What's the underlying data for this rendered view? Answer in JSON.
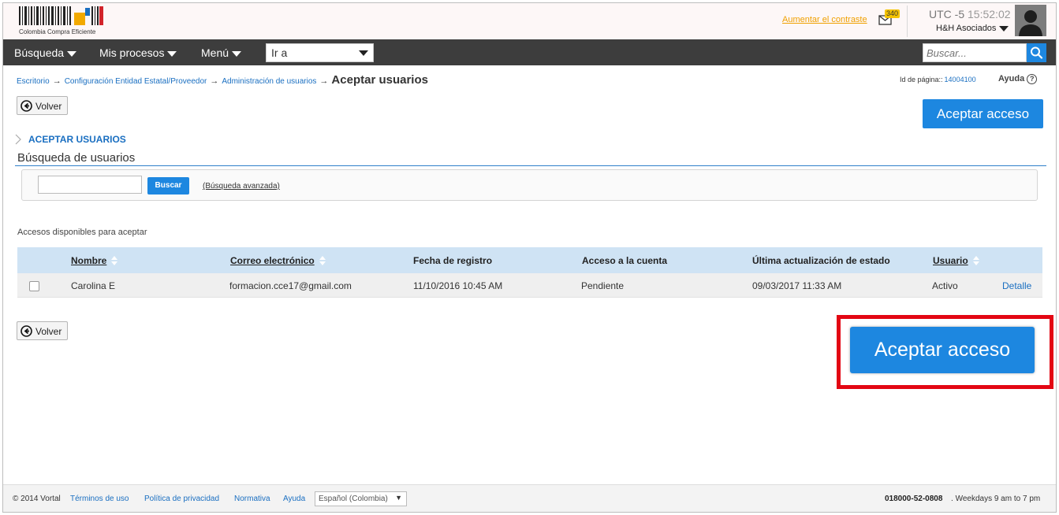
{
  "header": {
    "logo_caption": "Colombia Compra Eficiente",
    "contrast_link": "Aumentar el contraste",
    "mail_count": "340",
    "timezone": "UTC -5",
    "time": "15:52:02",
    "company": "H&H Asociados"
  },
  "nav": {
    "items": [
      {
        "label": "Búsqueda"
      },
      {
        "label": "Mis procesos"
      },
      {
        "label": "Menú"
      }
    ],
    "goto_value": "Ir a",
    "search_placeholder": "Buscar..."
  },
  "breadcrumb": {
    "items": [
      "Escritorio",
      "Configuración Entidad Estatal/Proveedor",
      "Administración de usuarios"
    ],
    "separator": "→",
    "current": "Aceptar usuarios"
  },
  "page_id": {
    "label": "Id de página::",
    "value": "14004100"
  },
  "help_label": "Ayuda",
  "help_symbol": "?",
  "buttons": {
    "back": "Volver",
    "accept": "Aceptar acceso",
    "search": "Buscar",
    "advanced": "(Búsqueda avanzada)"
  },
  "section": {
    "title": "ACEPTAR USUARIOS",
    "search_heading": "Búsqueda de usuarios",
    "table_caption": "Accesos disponibles para aceptar"
  },
  "table": {
    "headers": [
      "Nombre",
      "Correo electrónico",
      "Fecha de registro",
      "Acceso a la cuenta",
      "Última actualización de estado",
      "Usuario"
    ],
    "rows": [
      {
        "name": "Carolina E",
        "email": "formacion.cce17@gmail.com",
        "registered": "11/10/2016 10:45 AM",
        "access": "Pendiente",
        "updated": "09/03/2017 11:33 AM",
        "user_status": "Activo",
        "detail": "Detalle"
      }
    ]
  },
  "footer": {
    "copyright": "© 2014 Vortal",
    "links": [
      "Términos de uso",
      "Política de privacidad",
      "Normativa",
      "Ayuda"
    ],
    "language": "Español (Colombia)",
    "phone": "018000-52-0808",
    "hours": "Weekdays 9 am to 7 pm"
  },
  "colors": {
    "accent_blue": "#1d87e0",
    "nav_bg": "#3d3d3d",
    "highlight_red": "#e30613",
    "table_header": "#cfe3f4"
  }
}
